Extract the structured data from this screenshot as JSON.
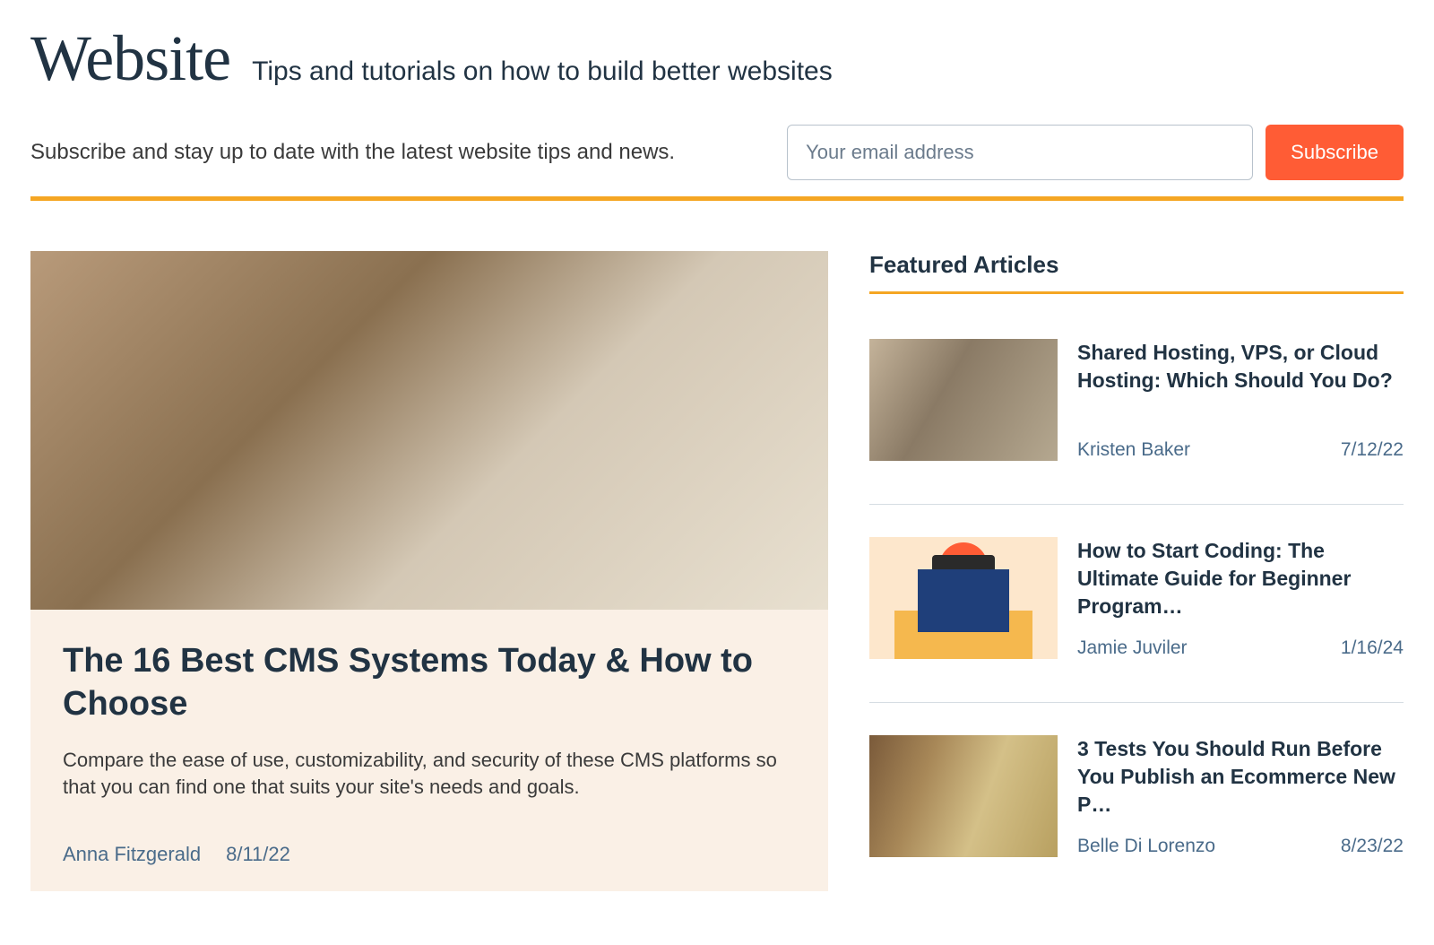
{
  "header": {
    "title": "Website",
    "tagline": "Tips and tutorials on how to build better websites"
  },
  "subscribe": {
    "text": "Subscribe and stay up to date with the latest website tips and news.",
    "placeholder": "Your email address",
    "button": "Subscribe"
  },
  "hero": {
    "title": "The 16 Best CMS Systems Today & How to Choose",
    "description": "Compare the ease of use, customizability, and security of these CMS platforms so that you can find one that suits your site's needs and goals.",
    "author": "Anna Fitzgerald",
    "date": "8/11/22"
  },
  "sidebar": {
    "heading": "Featured Articles",
    "items": [
      {
        "title": "Shared Hosting, VPS, or Cloud Hosting: Which Should You Do?",
        "author": "Kristen Baker",
        "date": "7/12/22"
      },
      {
        "title": "How to Start Coding: The Ultimate Guide for Beginner Program…",
        "author": "Jamie Juviler",
        "date": "1/16/24"
      },
      {
        "title": "3 Tests You Should Run Before You Publish an Ecommerce New P…",
        "author": "Belle Di Lorenzo",
        "date": "8/23/22"
      }
    ]
  }
}
